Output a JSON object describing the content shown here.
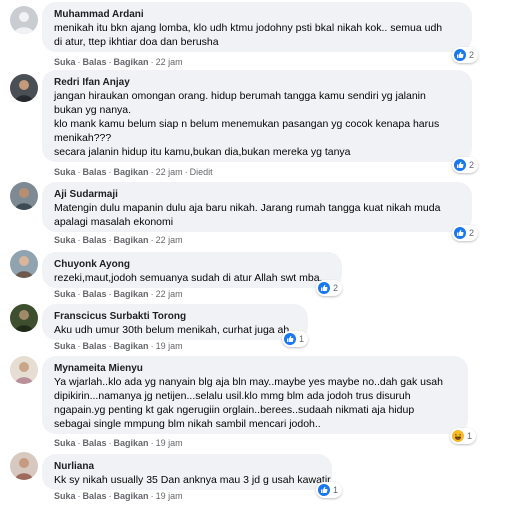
{
  "actions": {
    "like": "Suka",
    "reply": "Balas",
    "share": "Bagikan",
    "edited": "Diedit"
  },
  "comments": [
    {
      "name": "Muhammad Ardani",
      "lines": [
        "menikah itu bkn ajang lomba, klo udh ktmu jodohny psti bkal nikah kok.. semua udh",
        "di atur, ttep ikhtiar doa dan berusha"
      ],
      "time": "22 jam",
      "reaction_icon": "like-icon",
      "reactions": "2"
    },
    {
      "name": "Redri Ifan Anjay",
      "lines": [
        "jangan hiraukan omongan orang. hidup berumah tangga kamu sendiri yg jalanin",
        "bukan yg nanya.",
        "klo mank kamu belum siap n belum menemukan pasangan yg cocok kenapa harus",
        "menikah???",
        "secara jalanin hidup itu kamu,bukan dia,bukan mereka yg tanya"
      ],
      "time": "22 jam",
      "edited": true,
      "reaction_icon": "like-icon",
      "reactions": "2"
    },
    {
      "name": "Aji Sudarmaji",
      "lines": [
        "Matengin dulu mapanin dulu aja baru nikah. Jarang rumah tangga kuat nikah muda",
        "apalagi masalah ekonomi"
      ],
      "time": "22 jam",
      "reaction_icon": "like-icon",
      "reactions": "2"
    },
    {
      "name": "Chuyonk Ayong",
      "lines": [
        "rezeki,maut,jodoh semuanya sudah di atur Allah swt mba."
      ],
      "time": "22 jam",
      "reaction_icon": "like-icon",
      "reactions": "2"
    },
    {
      "name": "Franscicus Surbakti Torong",
      "lines": [
        "Aku udh umur 30th belum menikah, curhat juga ah"
      ],
      "time": "19 jam",
      "reaction_icon": "like-icon",
      "reactions": "1"
    },
    {
      "name": "Mynameita Mienyu",
      "lines": [
        "Ya wjarlah..klo ada yg nanyain blg aja bln may..maybe yes maybe no..dah gak usah",
        "dipikirin...namanya jg netijen...selalu usil.klo mmg blm ada jodoh trus disuruh",
        "ngapain.yg penting kt gak ngerugiin orglain..berees..sudaah nikmati aja hidup",
        "sebagai single mmpung blm nikah sambil mencari jodoh.."
      ],
      "time": "19 jam",
      "reaction_icon": "haha-icon",
      "reactions": "1"
    },
    {
      "name": "Nurliana",
      "lines": [
        "Kk sy nikah usually 35 Dan anknya mau 3 jd g usah kawatir"
      ],
      "time": "19 jam",
      "reaction_icon": "like-icon",
      "reactions": "1"
    }
  ]
}
